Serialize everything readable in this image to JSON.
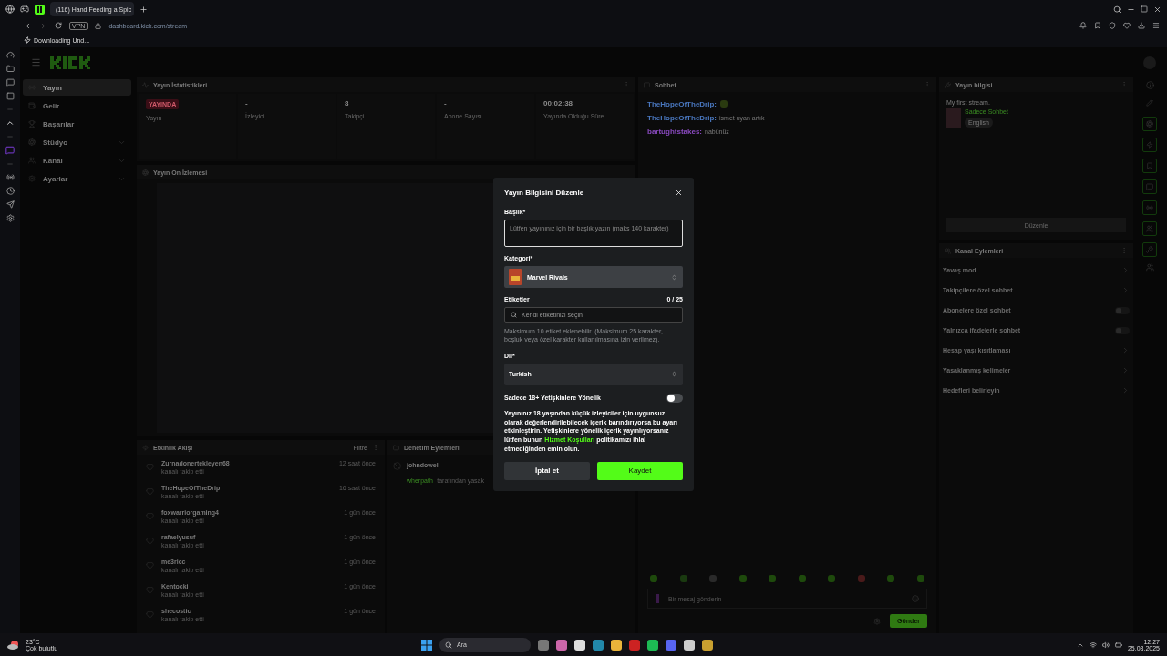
{
  "browser": {
    "tabs": [
      {
        "title": "(116) Hand Feeding a Spic",
        "selected": true
      }
    ],
    "vpn": "VPN",
    "url": "dashboard.kick.com/stream",
    "download": "Downloading Und..."
  },
  "nav": {
    "items": [
      {
        "label": "Yayın",
        "kind": "link",
        "selected": true
      },
      {
        "label": "Gelir",
        "kind": "link",
        "selected": false
      },
      {
        "label": "Başarılar",
        "kind": "link",
        "selected": false
      },
      {
        "label": "Stüdyo",
        "kind": "group",
        "selected": false
      },
      {
        "label": "Kanal",
        "kind": "group",
        "selected": false
      },
      {
        "label": "Ayarlar",
        "kind": "group",
        "selected": false
      }
    ]
  },
  "stats": {
    "title": "Yayın İstatistikleri",
    "cards": [
      {
        "kind": "badge",
        "value": "YAYINDA",
        "label": "Yayın"
      },
      {
        "kind": "number",
        "value": "-",
        "label": "İzleyici"
      },
      {
        "kind": "number",
        "value": "8",
        "label": "Takipçi"
      },
      {
        "kind": "number",
        "value": "-",
        "label": "Abone Sayısı"
      },
      {
        "kind": "number",
        "value": "00:02:38",
        "label": "Yayında Olduğu Süre"
      }
    ]
  },
  "preview": {
    "title": "Yayın Ön İzlemesi"
  },
  "events": {
    "title": "Etkinlik Akışı",
    "filter": "Filtre",
    "items": [
      {
        "name": "Zurnadonertekleyen68",
        "action": "kanalı takip etti",
        "time": "12 saat önce"
      },
      {
        "name": "TheHopeOfTheDrip",
        "action": "kanalı takip etti",
        "time": "16 saat önce"
      },
      {
        "name": "foxwarriorgaming4",
        "action": "kanalı takip etti",
        "time": "1 gün önce"
      },
      {
        "name": "rafaelyusuf",
        "action": "kanalı takip etti",
        "time": "1 gün önce"
      },
      {
        "name": "me3ricc",
        "action": "kanalı takip etti",
        "time": "1 gün önce"
      },
      {
        "name": "Kentocki",
        "action": "kanalı takip etti",
        "time": "1 gün önce"
      },
      {
        "name": "shecostic",
        "action": "kanalı takip etti",
        "time": "1 gün önce"
      }
    ]
  },
  "moderation": {
    "title": "Denetim Eylemleri",
    "items": [
      {
        "user": "johndowel",
        "moderator": "wherpath",
        "action": "tarafından yasak"
      }
    ]
  },
  "chat": {
    "title": "Sohbet",
    "messages": [
      {
        "kind": "emote",
        "user": "TheHopeOfTheDrip:",
        "color": "#4a78c0"
      },
      {
        "kind": "text",
        "user": "TheHopeOfTheDrip:",
        "color": "#4a78c0",
        "text": "ismet uyan artık"
      },
      {
        "kind": "text",
        "user": "bartughtstakes:",
        "color": "#8a4ac0",
        "text": "nabünüz"
      }
    ],
    "placeholder": "Bir mesaj gönderin",
    "send": "Gönder"
  },
  "stream_info": {
    "title": "Yayın bilgisi",
    "stream_title": "My first stream.",
    "category": "Sadece Sohbet",
    "tag": "English",
    "edit": "Düzenle"
  },
  "channel_actions": {
    "title": "Kanal Eylemleri",
    "items": [
      {
        "label": "Yavaş mod",
        "kind": "link"
      },
      {
        "label": "Takipçilere özel sohbet",
        "kind": "link"
      },
      {
        "label": "Abonelere özel sohbet",
        "kind": "toggle",
        "on": false
      },
      {
        "label": "Yalnızca ifadelerle sohbet",
        "kind": "toggle",
        "on": false
      },
      {
        "label": "Hesap yaşı kısıtlaması",
        "kind": "link"
      },
      {
        "label": "Yasaklanmış kelimeler",
        "kind": "link"
      },
      {
        "label": "Hedefleri belirleyin",
        "kind": "link"
      }
    ]
  },
  "modal": {
    "title": "Yayın Bilgisini Düzenle",
    "title_label": "Başlık*",
    "title_placeholder": "Lütfen yayınınız için bir başlık yazın (maks 140 karakter)",
    "category_label": "Kategori*",
    "category": "Marvel Rivals",
    "tags_label": "Etiketler",
    "tags_count": "0 / 25",
    "tags_placeholder": "Kendi etiketinizi seçin",
    "tags_hint": "Maksimum 10 etiket eklenebilir. (Maksimum 25 karakter, boşluk veya özel karakter kullanılmasına izin verilmez).",
    "language_label": "Dil*",
    "language": "Turkish",
    "adult_label": "Sadece 18+ Yetişkinlere Yönelik",
    "adult_on": false,
    "notice_before": "Yayınınız 18 yaşından küçük izleyiciler için uygunsuz olarak değerlendirilebilecek içerik barındırıyorsa bu ayarı etkinleştirin. Yetişkinlere yönelik içerik yayınlıyorsanız lütfen bunun",
    "notice_link": "Hizmet Koşulları",
    "notice_after": "politikamızı ihlal etmediğinden emin olun.",
    "cancel": "İptal et",
    "save": "Kaydet"
  },
  "taskbar": {
    "temperature": "23°C",
    "weather": "Çok bulutlu",
    "search": "Ara",
    "time": "12:27",
    "date": "25.08.2025"
  }
}
